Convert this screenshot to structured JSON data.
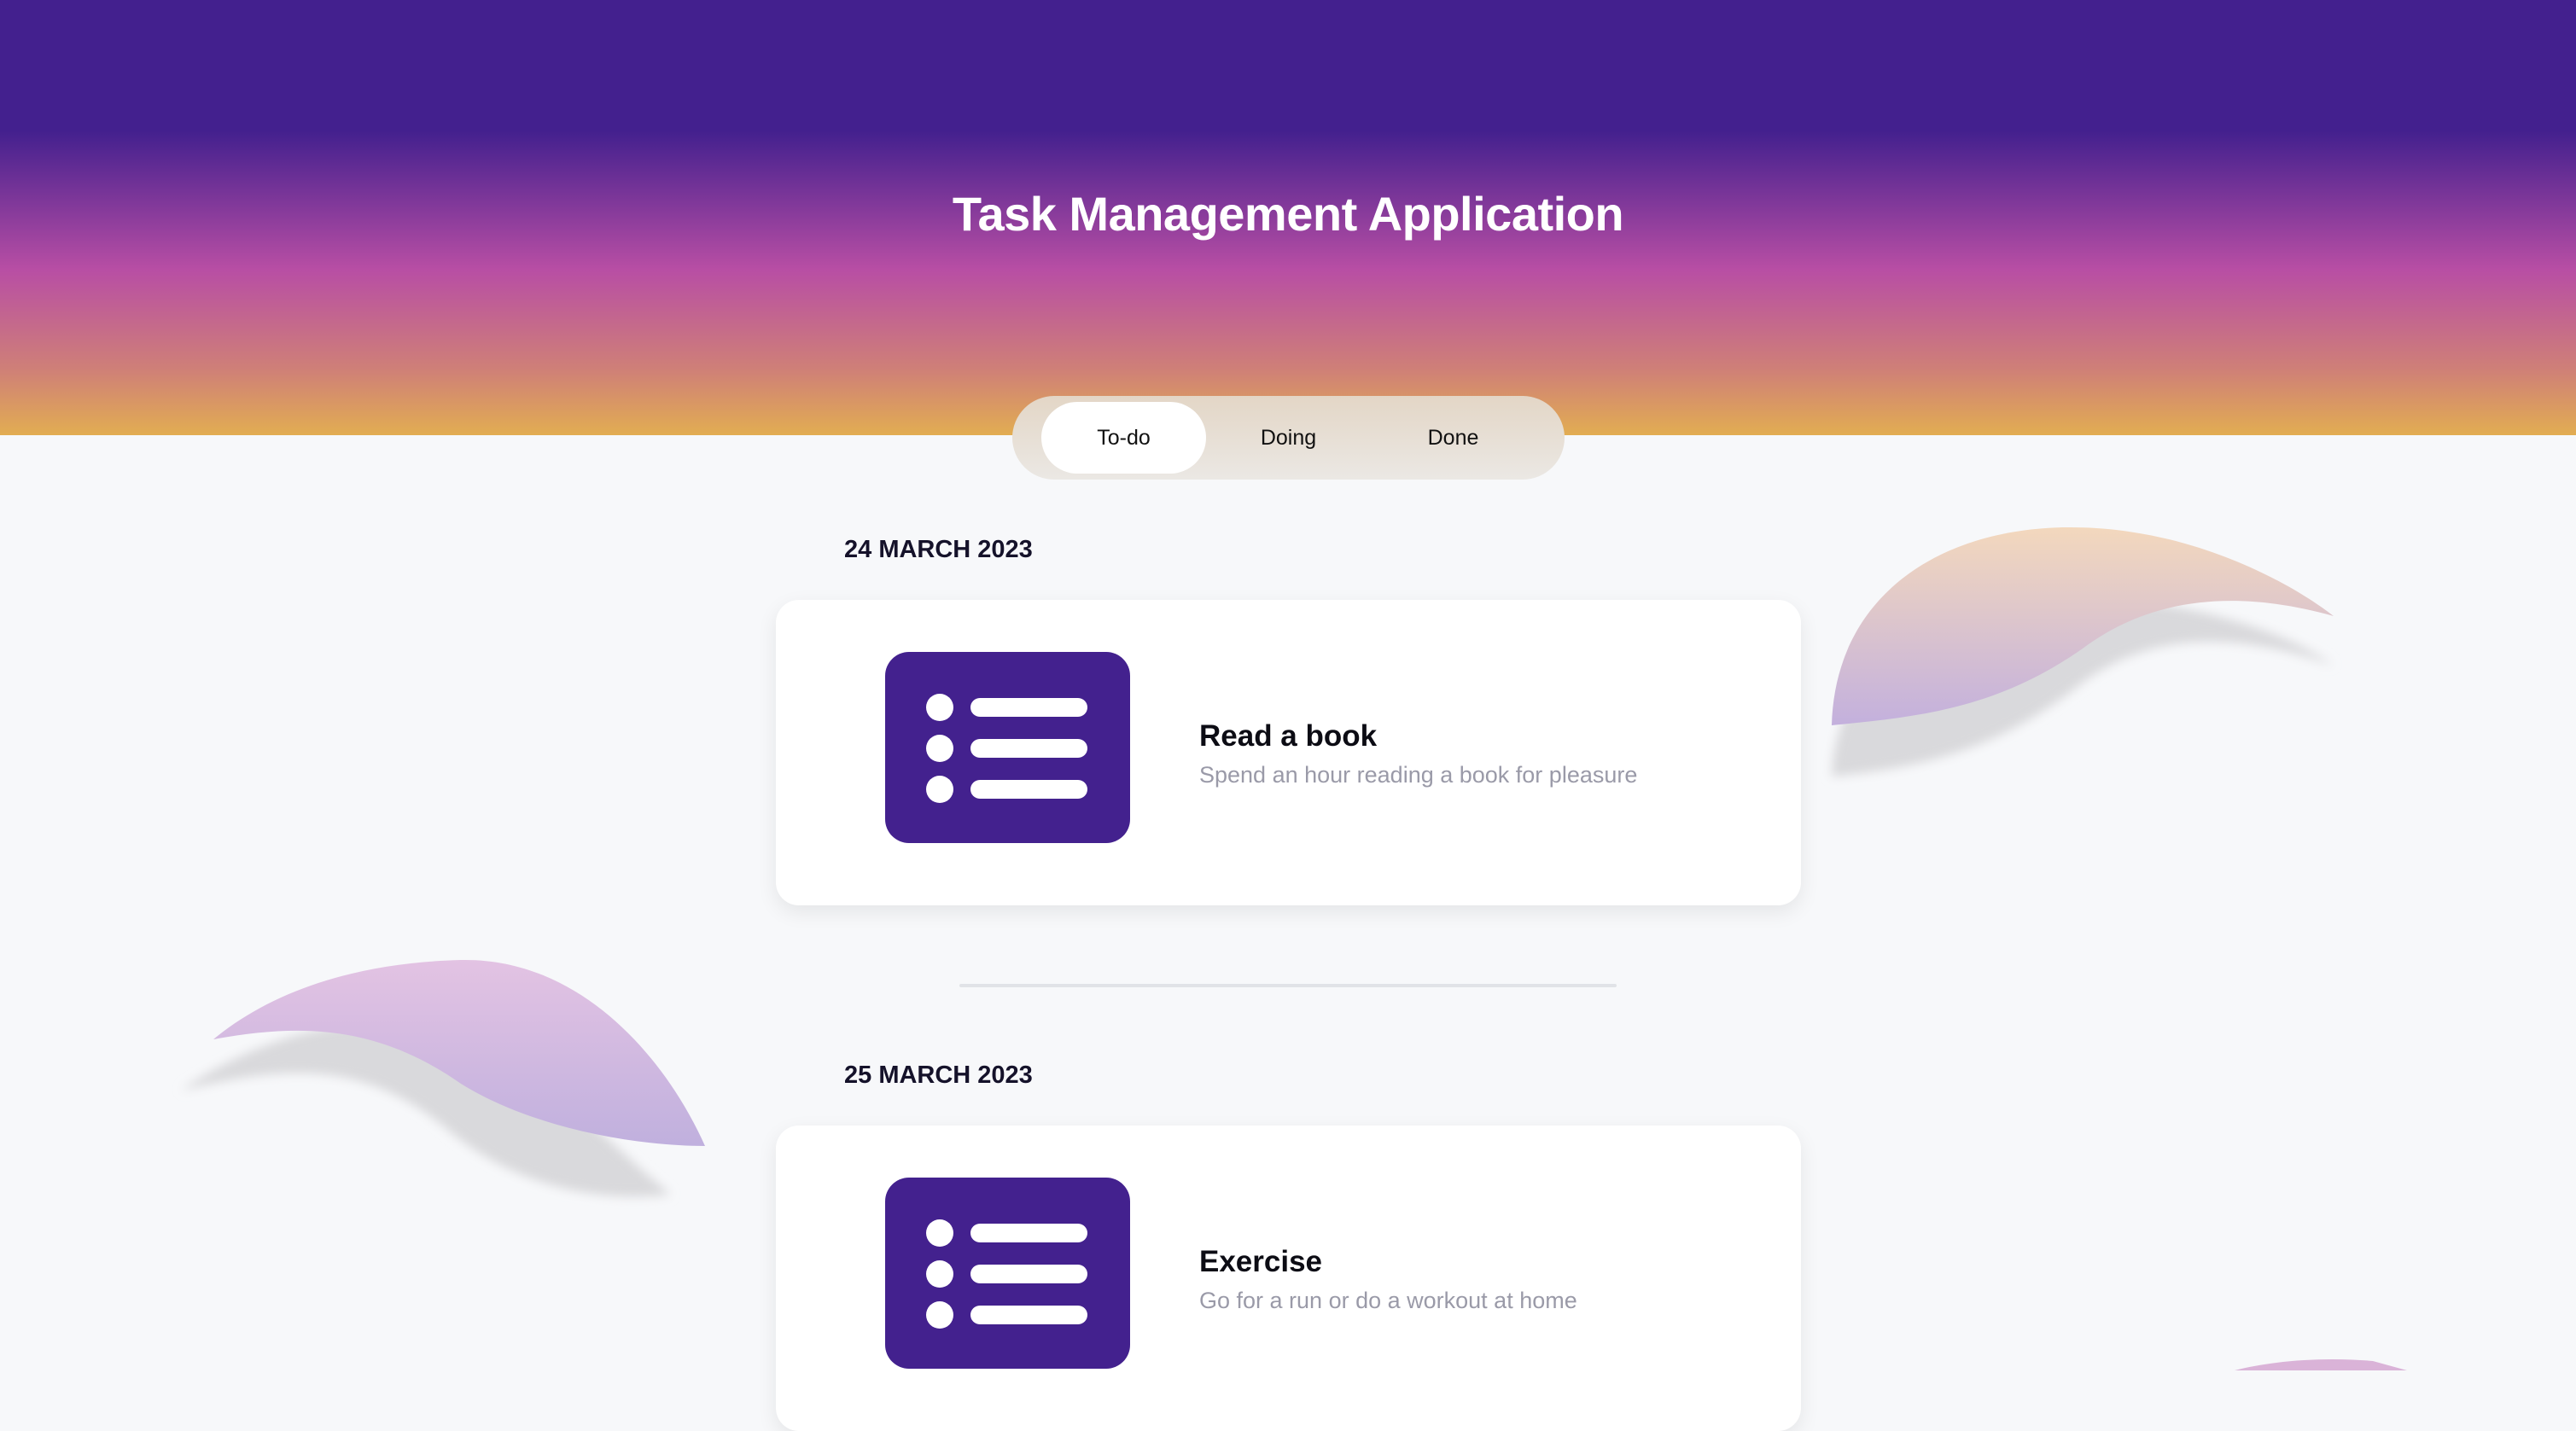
{
  "header": {
    "title": "Task Management Application"
  },
  "tabs": [
    {
      "label": "To-do",
      "active": true
    },
    {
      "label": "Doing",
      "active": false
    },
    {
      "label": "Done",
      "active": false
    }
  ],
  "groups": [
    {
      "date": "24 MARCH 2023",
      "task": {
        "title": "Read a book",
        "description": "Spend an hour reading a book for pleasure",
        "icon": "list-icon"
      }
    },
    {
      "date": "25 MARCH 2023",
      "task": {
        "title": "Exercise",
        "description": "Go for a run or do a workout at home",
        "icon": "list-icon"
      }
    }
  ],
  "colors": {
    "primary": "#43218e",
    "accent_pink": "#b84ea4",
    "accent_gold": "#e2ad52"
  }
}
